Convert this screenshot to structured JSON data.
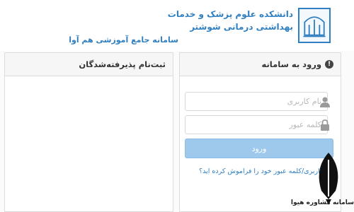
{
  "header": {
    "university_line1": "دانشکده علوم پزشک و خدمات",
    "university_line2": "بهداشتی درمانی شوشتر",
    "system_name": "سامانه جامع آموزشی هم آوا"
  },
  "registration_panel": {
    "title": "ثبت‌نام پذیرفته‌شدگان"
  },
  "login_panel": {
    "title": "ورود به سامانه",
    "username_placeholder": "نام کاربری",
    "password_placeholder": "کلمه عبور",
    "login_button": "ورود",
    "forgot_link": "نام کاربری/کلمه عبور خود را فراموش کرده اید؟"
  },
  "watermark": {
    "text": "سامانه مشاوره هیوا"
  },
  "colors": {
    "brand_blue": "#2f7fc1",
    "button_blue": "#9ec8ec"
  },
  "icons": [
    "university-logo",
    "info-icon",
    "user-icon",
    "lock-icon",
    "quill-icon"
  ]
}
